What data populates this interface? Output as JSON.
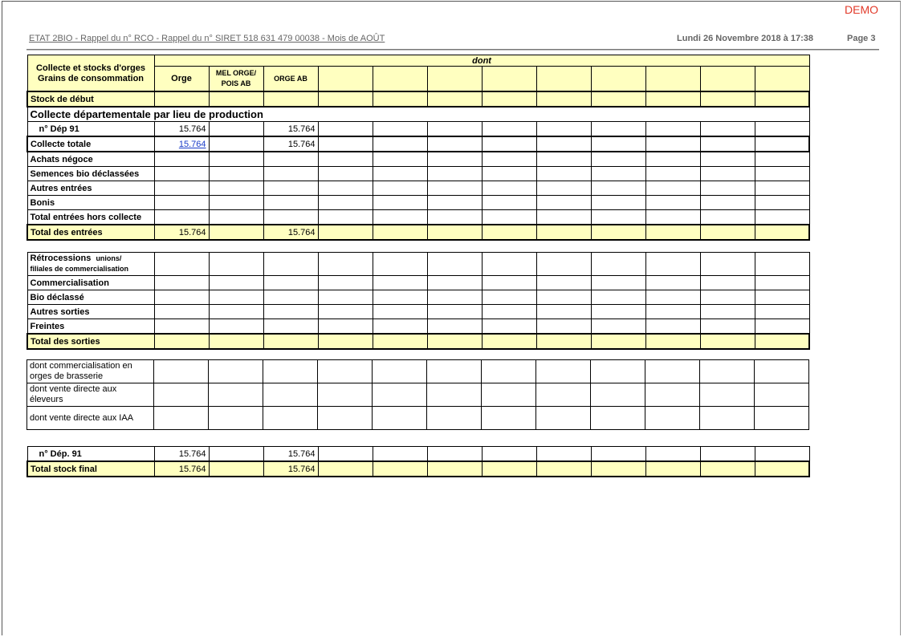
{
  "demo": "DEMO",
  "header": {
    "title": "ETAT 2BIO  -  Rappel du n° RCO  - Rappel du n° SIRET 518 631 479 00038 -  Mois de AOÛT",
    "date": "Lundi 26 Novembre 2018 à 17:38",
    "page": "Page 3"
  },
  "table": {
    "dont": "dont",
    "row_header_line1": "Collecte et stocks d'orges",
    "row_header_line2": "Grains de consommation",
    "columns": [
      "Orge",
      "MEL ORGE/",
      "POIS AB",
      "ORGE AB"
    ],
    "stock_debut": "Stock de début",
    "collecte_dep_title": "Collecte départementale par lieu de production",
    "dep91": {
      "label": "n° Dép 91",
      "orge": "15.764",
      "orge_ab": "15.764"
    },
    "collecte_totale": {
      "label": "Collecte totale",
      "orge": "15.764",
      "orge_ab": "15.764"
    },
    "achats": "Achats négoce",
    "semences": "Semences bio déclassées",
    "autres_entrees": "Autres entrées",
    "bonis": "Bonis",
    "total_hors_collecte": "Total entrées hors collecte",
    "total_entrees": {
      "label": "Total des entrées",
      "orge": "15.764",
      "orge_ab": "15.764"
    },
    "retro_a": "Rétrocessions",
    "retro_b": "unions/",
    "retro_c": "filiales de commercialisation",
    "commercialisation": "Commercialisation",
    "bio_declasse": "Bio déclassé",
    "autres_sorties": "Autres sorties",
    "freintes": "Freintes",
    "total_sorties": "Total des sorties",
    "dont_brasserie": "dont commercialisation en orges de brasserie",
    "dont_eleveurs": "dont vente directe aux éleveurs",
    "dont_iaa": "dont vente directe aux IAA",
    "final_dep": {
      "label": "n° Dép. 91",
      "orge": "15.764",
      "orge_ab": "15.764"
    },
    "total_stock_final": {
      "label": "Total stock final",
      "orge": "15.764",
      "orge_ab": "15.764"
    }
  }
}
